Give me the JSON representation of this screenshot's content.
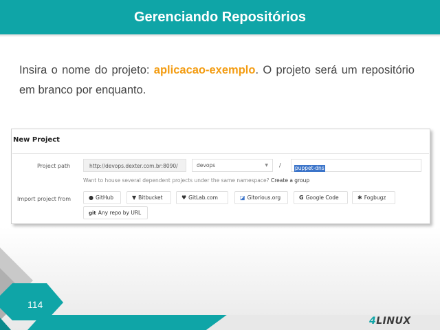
{
  "slide": {
    "title": "Gerenciando Repositórios",
    "intro_before": "Insira o nome do projeto: ",
    "intro_highlight": "aplicacao-exemplo",
    "intro_after": ". O projeto será um repositório em branco por enquanto.",
    "page_number": "114",
    "logo_prefix": "4",
    "logo_text": "LINUX",
    "colors": {
      "accent": "#0fa5a7",
      "highlight": "#f39c12"
    }
  },
  "form": {
    "title": "New Project",
    "project_path_label": "Project path",
    "url_prefix": "http://devops.dexter.com.br:8090/",
    "namespace": "devops",
    "separator": "/",
    "project_name": "puppet-dns",
    "hint_text": "Want to house several dependent projects under the same namespace? ",
    "hint_link": "Create a group",
    "import_label": "Import project from",
    "import_sources": [
      {
        "label": "GitHub",
        "icon": "github-icon"
      },
      {
        "label": "Bitbucket",
        "icon": "bitbucket-icon"
      },
      {
        "label": "GitLab.com",
        "icon": "heart-icon"
      },
      {
        "label": "Gitorious.org",
        "icon": "gitorious-icon"
      },
      {
        "label": "Google Code",
        "icon": "google-icon"
      },
      {
        "label": "Fogbugz",
        "icon": "bug-icon"
      },
      {
        "label": "Any repo by URL",
        "icon": "git-icon"
      }
    ]
  }
}
